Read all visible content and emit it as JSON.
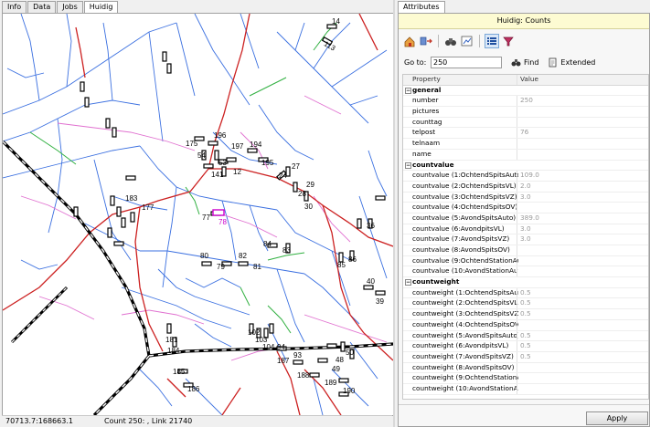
{
  "left_tabs": [
    "Info",
    "Data",
    "Jobs",
    "Huidig"
  ],
  "right_tabs": [
    "Attributes"
  ],
  "attr_header": "Huidig: Counts",
  "toolbar_icons": [
    "home-search-icon",
    "navigate-icon",
    "binoculars-icon",
    "chart-edit-icon",
    "list-view-icon",
    "filter-icon"
  ],
  "goto": {
    "label": "Go to:",
    "value": "250",
    "find": "Find",
    "extended": "Extended"
  },
  "grid": {
    "col_property": "Property",
    "col_value": "Value",
    "rows": [
      {
        "type": "cat",
        "p": "general",
        "v": ""
      },
      {
        "type": "row",
        "p": "number",
        "v": "250"
      },
      {
        "type": "row",
        "p": "pictures",
        "v": ""
      },
      {
        "type": "row",
        "p": "counttag",
        "v": ""
      },
      {
        "type": "row",
        "p": "telpost",
        "v": "76"
      },
      {
        "type": "row",
        "p": "telnaam",
        "v": ""
      },
      {
        "type": "row",
        "p": "name",
        "v": ""
      },
      {
        "type": "cat",
        "p": "countvalue",
        "v": ""
      },
      {
        "type": "row",
        "p": "countvalue (1:OchtendSpitsAuto)",
        "v": "109.0"
      },
      {
        "type": "row",
        "p": "countvalue (2:OchtendSpitsVL)",
        "v": "2.0"
      },
      {
        "type": "row",
        "p": "countvalue (3:OchtendSpitsVZ)",
        "v": "3.0"
      },
      {
        "type": "row",
        "p": "countvalue (4:OchtendSpitsOV)",
        "v": ""
      },
      {
        "type": "row",
        "p": "countvalue (5:AvondSpitsAuto)",
        "v": "389.0"
      },
      {
        "type": "row",
        "p": "countvalue (6:AvondpitsVL)",
        "v": "3.0"
      },
      {
        "type": "row",
        "p": "countvalue (7:AvondSpitsVZ)",
        "v": "3.0"
      },
      {
        "type": "row",
        "p": "countvalue (8:AvondSpitsOV)",
        "v": ""
      },
      {
        "type": "row",
        "p": "countvalue (9:OchtendStationAuto)",
        "v": ""
      },
      {
        "type": "row",
        "p": "countvalue (10:AvondStationAuto)",
        "v": ""
      },
      {
        "type": "cat",
        "p": "countweight",
        "v": ""
      },
      {
        "type": "row",
        "p": "countweight (1:OchtendSpitsAuto)",
        "v": "0.5"
      },
      {
        "type": "row",
        "p": "countweight (2:OchtendSpitsVL)",
        "v": "0.5"
      },
      {
        "type": "row",
        "p": "countweight (3:OchtendSpitsVZ)",
        "v": "0.5"
      },
      {
        "type": "row",
        "p": "countweight (4:OchtendSpitsOV)",
        "v": ""
      },
      {
        "type": "row",
        "p": "countweight (5:AvondSpitsAuto)",
        "v": "0.5"
      },
      {
        "type": "row",
        "p": "countweight (6:AvondpitsVL)",
        "v": "0.5"
      },
      {
        "type": "row",
        "p": "countweight (7:AvondSpitsVZ)",
        "v": "0.5"
      },
      {
        "type": "row",
        "p": "countweight (8:AvondSpitsOV)",
        "v": ""
      },
      {
        "type": "row",
        "p": "countweight (9:OchtendStationAuto)",
        "v": ""
      },
      {
        "type": "row",
        "p": "countweight (10:AvondStationAuto)",
        "v": ""
      }
    ]
  },
  "apply_label": "Apply",
  "status": {
    "coords": "70713.7:168663.1",
    "info": "Count 250: , Link 21740"
  },
  "map_labels": [
    "14",
    "113",
    "175",
    "196",
    "197",
    "194",
    "195",
    "54",
    "53",
    "141",
    "12",
    "24",
    "27",
    "28",
    "29",
    "30",
    "183",
    "177",
    "77",
    "78",
    "36",
    "86",
    "85",
    "80",
    "79",
    "82",
    "81",
    "84",
    "83",
    "40",
    "39",
    "181",
    "184",
    "185",
    "186",
    "187",
    "188",
    "189",
    "190",
    "93",
    "94",
    "50",
    "48",
    "49",
    "102",
    "103",
    "104"
  ],
  "colors": {
    "accent_header": "#fdfbd2",
    "road_red": "#cc2020",
    "road_blue": "#3a6fe0",
    "road_pink": "#e070d0",
    "road_green": "#30b040",
    "selected_label": "#cc00cc"
  }
}
